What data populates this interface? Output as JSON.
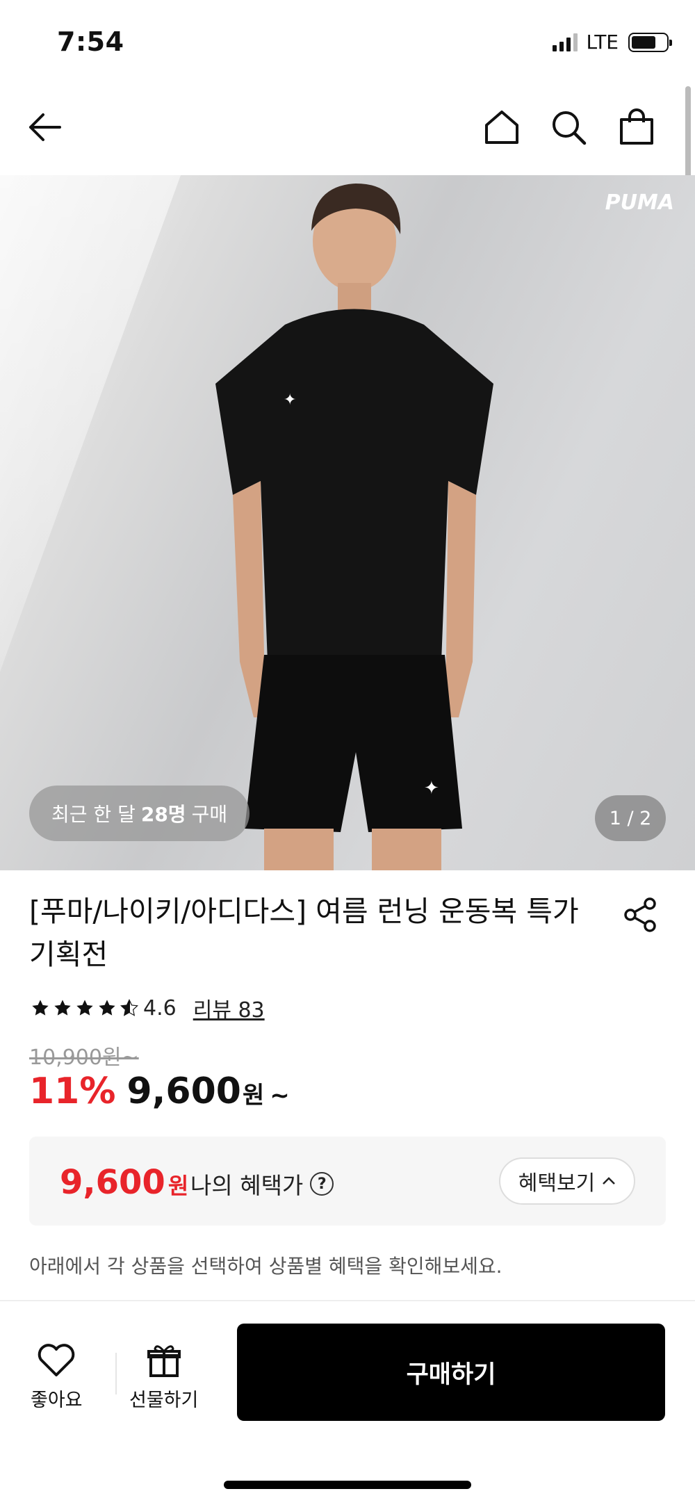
{
  "status_bar": {
    "time": "7:54",
    "network": "LTE"
  },
  "header": {
    "icons": [
      "back-arrow-icon",
      "home-icon",
      "search-icon",
      "shopping-bag-icon"
    ]
  },
  "hero": {
    "brand_watermark": "PUMA",
    "recent_purchase": {
      "prefix": "최근 한 달",
      "count": "28명",
      "suffix": "구매"
    },
    "pager": "1 / 2"
  },
  "product": {
    "title": "[푸마/나이키/아디다스] 여름 런닝 운동복 특가 기획전",
    "rating": "4.6",
    "rating_stars": 4.5,
    "review_label": "리뷰 83",
    "original_price": "10,900원~",
    "discount_rate": "11%",
    "price": "9,600",
    "price_unit": "원",
    "price_suffix": "~"
  },
  "benefit": {
    "price": "9,600",
    "unit": "원",
    "label": "나의 혜택가",
    "help": "?",
    "button_label": "혜택보기"
  },
  "notice": "아래에서 각 상품을 선택하여 상품별 혜택을 확인해보세요.",
  "bottom_bar": {
    "like_label": "좋아요",
    "gift_label": "선물하기",
    "buy_label": "구매하기"
  },
  "colors": {
    "accent_red": "#e8242a",
    "buy_button": "#000000"
  }
}
